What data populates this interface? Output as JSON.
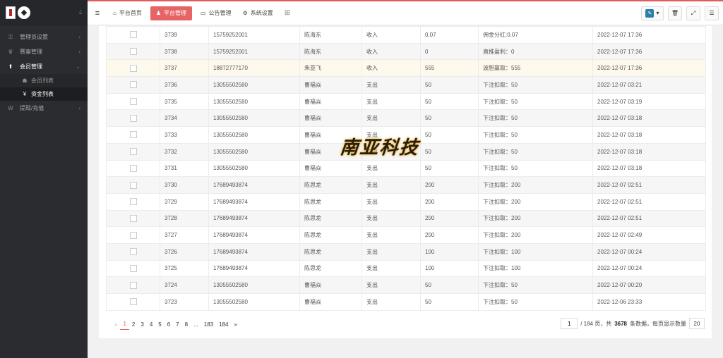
{
  "sidebar": {
    "items": [
      {
        "label": "管理员设置",
        "icon": "key-icon",
        "glyph": "⚿"
      },
      {
        "label": "赛事管理",
        "icon": "trophy-icon",
        "glyph": "♛"
      },
      {
        "label": "会员管理",
        "icon": "user-icon",
        "glyph": "⬆",
        "expanded": true
      },
      {
        "label": "提现/充值",
        "icon": "wallet-icon",
        "glyph": "W"
      }
    ],
    "sub_items": [
      {
        "label": "会员列表",
        "icon": "users-icon",
        "glyph": "☗"
      },
      {
        "label": "资金列表",
        "icon": "yen-icon",
        "glyph": "¥",
        "current": true
      }
    ]
  },
  "topbar": {
    "tabs": [
      {
        "label": "平台首页",
        "icon": "home-icon",
        "glyph": "⌂"
      },
      {
        "label": "平台管理",
        "icon": "user-icon",
        "glyph": "♟",
        "active": true
      },
      {
        "label": "公告管理",
        "icon": "card-icon",
        "glyph": "▭"
      },
      {
        "label": "系统设置",
        "icon": "gear-icon",
        "glyph": "⚙"
      }
    ]
  },
  "table": {
    "rows": [
      {
        "id": "3739",
        "phone": "15759252001",
        "name": "陈海东",
        "type": "收入",
        "amount": "0.07",
        "note": "佣金分红:0.07",
        "time": "2022-12-07 17:36"
      },
      {
        "id": "3738",
        "phone": "15759252001",
        "name": "陈海东",
        "type": "收入",
        "amount": "0",
        "note": "直推盈利：0",
        "time": "2022-12-07 17:36"
      },
      {
        "id": "3737",
        "phone": "18872777170",
        "name": "朱亚飞",
        "type": "收入",
        "amount": "555",
        "note": "波胆赢取：555",
        "time": "2022-12-07 17:36",
        "highlight": true
      },
      {
        "id": "3736",
        "phone": "13055502580",
        "name": "曹福焱",
        "type": "支出",
        "amount": "50",
        "note": "下注扣取：50",
        "time": "2022-12-07 03:21"
      },
      {
        "id": "3735",
        "phone": "13055502580",
        "name": "曹福焱",
        "type": "支出",
        "amount": "50",
        "note": "下注扣取：50",
        "time": "2022-12-07 03:19"
      },
      {
        "id": "3734",
        "phone": "13055502580",
        "name": "曹福焱",
        "type": "支出",
        "amount": "50",
        "note": "下注扣取：50",
        "time": "2022-12-07 03:18"
      },
      {
        "id": "3733",
        "phone": "13055502580",
        "name": "曹福焱",
        "type": "支出",
        "amount": "50",
        "note": "下注扣取：50",
        "time": "2022-12-07 03:18"
      },
      {
        "id": "3732",
        "phone": "13055502580",
        "name": "曹福焱",
        "type": "支出",
        "amount": "50",
        "note": "下注扣取：50",
        "time": "2022-12-07 03:18"
      },
      {
        "id": "3731",
        "phone": "13055502580",
        "name": "曹福焱",
        "type": "支出",
        "amount": "50",
        "note": "下注扣取：50",
        "time": "2022-12-07 03:18"
      },
      {
        "id": "3730",
        "phone": "17689493874",
        "name": "陈思龙",
        "type": "支出",
        "amount": "200",
        "note": "下注扣取：200",
        "time": "2022-12-07 02:51"
      },
      {
        "id": "3729",
        "phone": "17689493874",
        "name": "陈思龙",
        "type": "支出",
        "amount": "200",
        "note": "下注扣取：200",
        "time": "2022-12-07 02:51"
      },
      {
        "id": "3728",
        "phone": "17689493874",
        "name": "陈思龙",
        "type": "支出",
        "amount": "200",
        "note": "下注扣取：200",
        "time": "2022-12-07 02:51"
      },
      {
        "id": "3727",
        "phone": "17689493874",
        "name": "陈思龙",
        "type": "支出",
        "amount": "200",
        "note": "下注扣取：200",
        "time": "2022-12-07 02:49"
      },
      {
        "id": "3726",
        "phone": "17689493874",
        "name": "陈思龙",
        "type": "支出",
        "amount": "100",
        "note": "下注扣取：100",
        "time": "2022-12-07 00:24"
      },
      {
        "id": "3725",
        "phone": "17689493874",
        "name": "陈思龙",
        "type": "支出",
        "amount": "100",
        "note": "下注扣取：100",
        "time": "2022-12-07 00:24"
      },
      {
        "id": "3724",
        "phone": "13055502580",
        "name": "曹福焱",
        "type": "支出",
        "amount": "50",
        "note": "下注扣取：50",
        "time": "2022-12-07 00:20"
      },
      {
        "id": "3723",
        "phone": "13055502580",
        "name": "曹福焱",
        "type": "支出",
        "amount": "50",
        "note": "下注扣取：50",
        "time": "2022-12-06 23:33"
      }
    ]
  },
  "pagination": {
    "prev": "«",
    "next": "»",
    "pages": [
      "1",
      "2",
      "3",
      "4",
      "5",
      "6",
      "7",
      "8",
      "...",
      "183",
      "184"
    ],
    "current": "1",
    "page_input": "1",
    "total_pages_text": "/ 184 页，共",
    "total_count": "3678",
    "count_suffix": "条数据，每页显示数量",
    "page_size": "20"
  },
  "watermark": "南亚科技",
  "colors": {
    "accent": "#e76464",
    "sidebar_bg": "#2b2c30",
    "highlight_row": "#fdf9ec"
  }
}
